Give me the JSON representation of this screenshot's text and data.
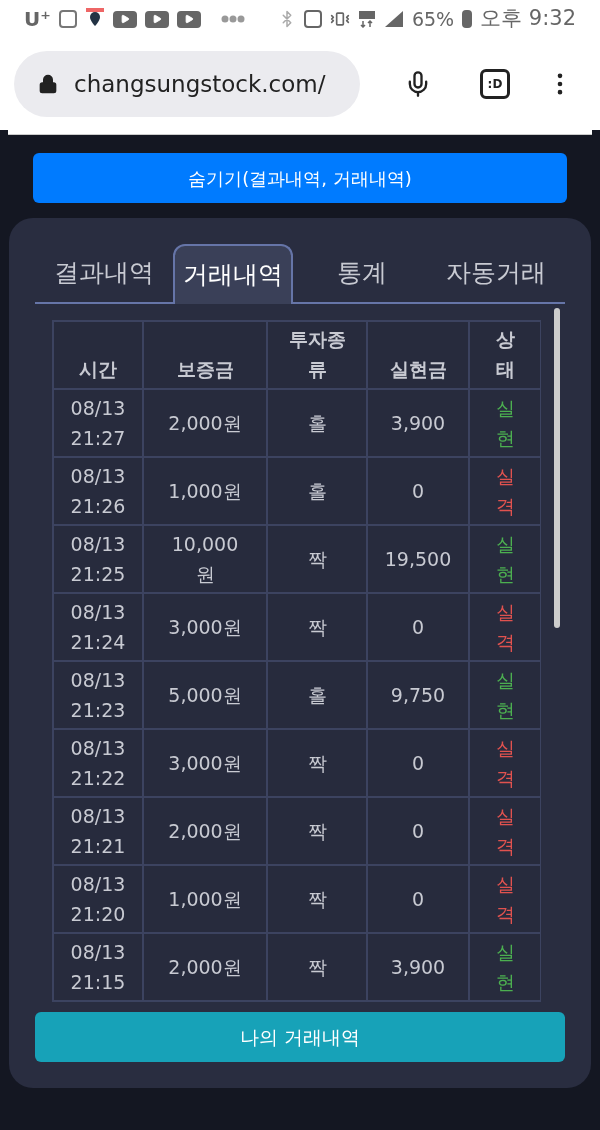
{
  "status_bar": {
    "carrier": "U⁺",
    "battery": "65%",
    "time": "오후 9:32"
  },
  "browser": {
    "url": "changsungstock.com/",
    "tab_count": ":D"
  },
  "hide_button": "숨기기(결과내역, 거래내역)",
  "tabs": [
    {
      "label": "결과내역",
      "selected": false
    },
    {
      "label": "거래내역",
      "selected": true
    },
    {
      "label": "통계",
      "selected": false
    },
    {
      "label": "자동거래",
      "selected": false
    }
  ],
  "table": {
    "columns": [
      "시간",
      "보증금",
      "투자종류",
      "실현금",
      "상태"
    ],
    "rows": [
      {
        "date": "08/13",
        "time": "21:27",
        "deposit": "2,000원",
        "type": "홀",
        "payout": "3,900",
        "status": "실현",
        "color": "#4caf50"
      },
      {
        "date": "08/13",
        "time": "21:26",
        "deposit": "1,000원",
        "type": "홀",
        "payout": "0",
        "status": "실격",
        "color": "#e0524f"
      },
      {
        "date": "08/13",
        "time": "21:25",
        "deposit": "10,000원",
        "type": "짝",
        "payout": "19,500",
        "status": "실현",
        "color": "#4caf50"
      },
      {
        "date": "08/13",
        "time": "21:24",
        "deposit": "3,000원",
        "type": "짝",
        "payout": "0",
        "status": "실격",
        "color": "#e0524f"
      },
      {
        "date": "08/13",
        "time": "21:23",
        "deposit": "5,000원",
        "type": "홀",
        "payout": "9,750",
        "status": "실현",
        "color": "#4caf50"
      },
      {
        "date": "08/13",
        "time": "21:22",
        "deposit": "3,000원",
        "type": "짝",
        "payout": "0",
        "status": "실격",
        "color": "#e0524f"
      },
      {
        "date": "08/13",
        "time": "21:21",
        "deposit": "2,000원",
        "type": "짝",
        "payout": "0",
        "status": "실격",
        "color": "#e0524f"
      },
      {
        "date": "08/13",
        "time": "21:20",
        "deposit": "1,000원",
        "type": "짝",
        "payout": "0",
        "status": "실격",
        "color": "#e0524f"
      },
      {
        "date": "08/13",
        "time": "21:15",
        "deposit": "2,000원",
        "type": "짝",
        "payout": "3,900",
        "status": "실현",
        "color": "#4caf50"
      }
    ]
  },
  "my_trades_button": "나의 거래내역"
}
